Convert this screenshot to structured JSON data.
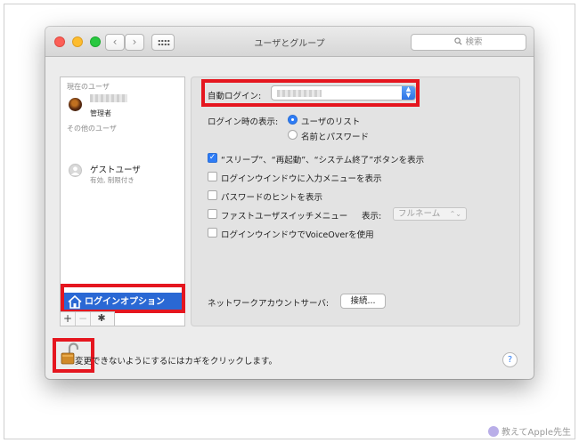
{
  "window": {
    "title": "ユーザとグループ",
    "search_placeholder": "検索",
    "back_glyph": "‹",
    "forward_glyph": "›"
  },
  "sidebar": {
    "current_user_label": "現在のユーザ",
    "current_user_role": "管理者",
    "other_users_label": "その他のユーザ",
    "guest_name": "ゲストユーザ",
    "guest_status": "有効, 制限付き",
    "login_options_label": "ログインオプション",
    "add_glyph": "+",
    "remove_glyph": "−",
    "gear_glyph": "✱"
  },
  "panel": {
    "auto_login_label": "自動ログイン:",
    "login_display_label": "ログイン時の表示:",
    "radio_user_list": "ユーザのリスト",
    "radio_name_password": "名前とパスワード",
    "radio_selected": "user_list",
    "opt_sleep_buttons": "“スリープ”、“再起動”、“システム終了”ボタンを表示",
    "opt_input_menu": "ログインウインドウに入力メニューを表示",
    "opt_password_hints": "パスワードのヒントを表示",
    "opt_fast_user_switch": "ファストユーザスイッチメニュー",
    "display_label": "表示:",
    "display_value": "フルネーム",
    "opt_voiceover": "ログインウインドウでVoiceOverを使用",
    "checked": {
      "sleep_buttons": true,
      "input_menu": false,
      "password_hints": false,
      "fast_user_switch": false,
      "voiceover": false
    },
    "network_server_label": "ネットワークアカウントサーバ:",
    "connect_button": "接続..."
  },
  "footer": {
    "lock_text": "変更できないようにするにはカギをクリックします。",
    "help_glyph": "?"
  },
  "watermark": "教えてApple先生",
  "colors": {
    "highlight_red": "#e5161f",
    "selection_blue": "#2a68d4",
    "control_blue": "#2e7cf6"
  }
}
